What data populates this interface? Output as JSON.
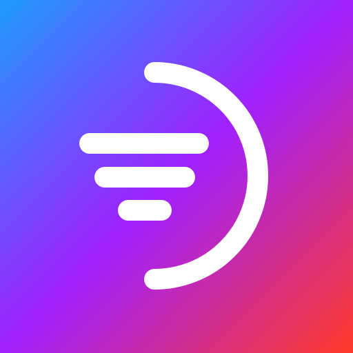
{
  "icon": {
    "name": "filter-arc-app-icon",
    "glyph": "filter-lines-with-arc",
    "colors": {
      "gradient_top_left": "#1E9BFF",
      "gradient_middle": "#A020FF",
      "gradient_bottom_right": "#FF3A28",
      "glyph": "#FFFFFF"
    }
  }
}
